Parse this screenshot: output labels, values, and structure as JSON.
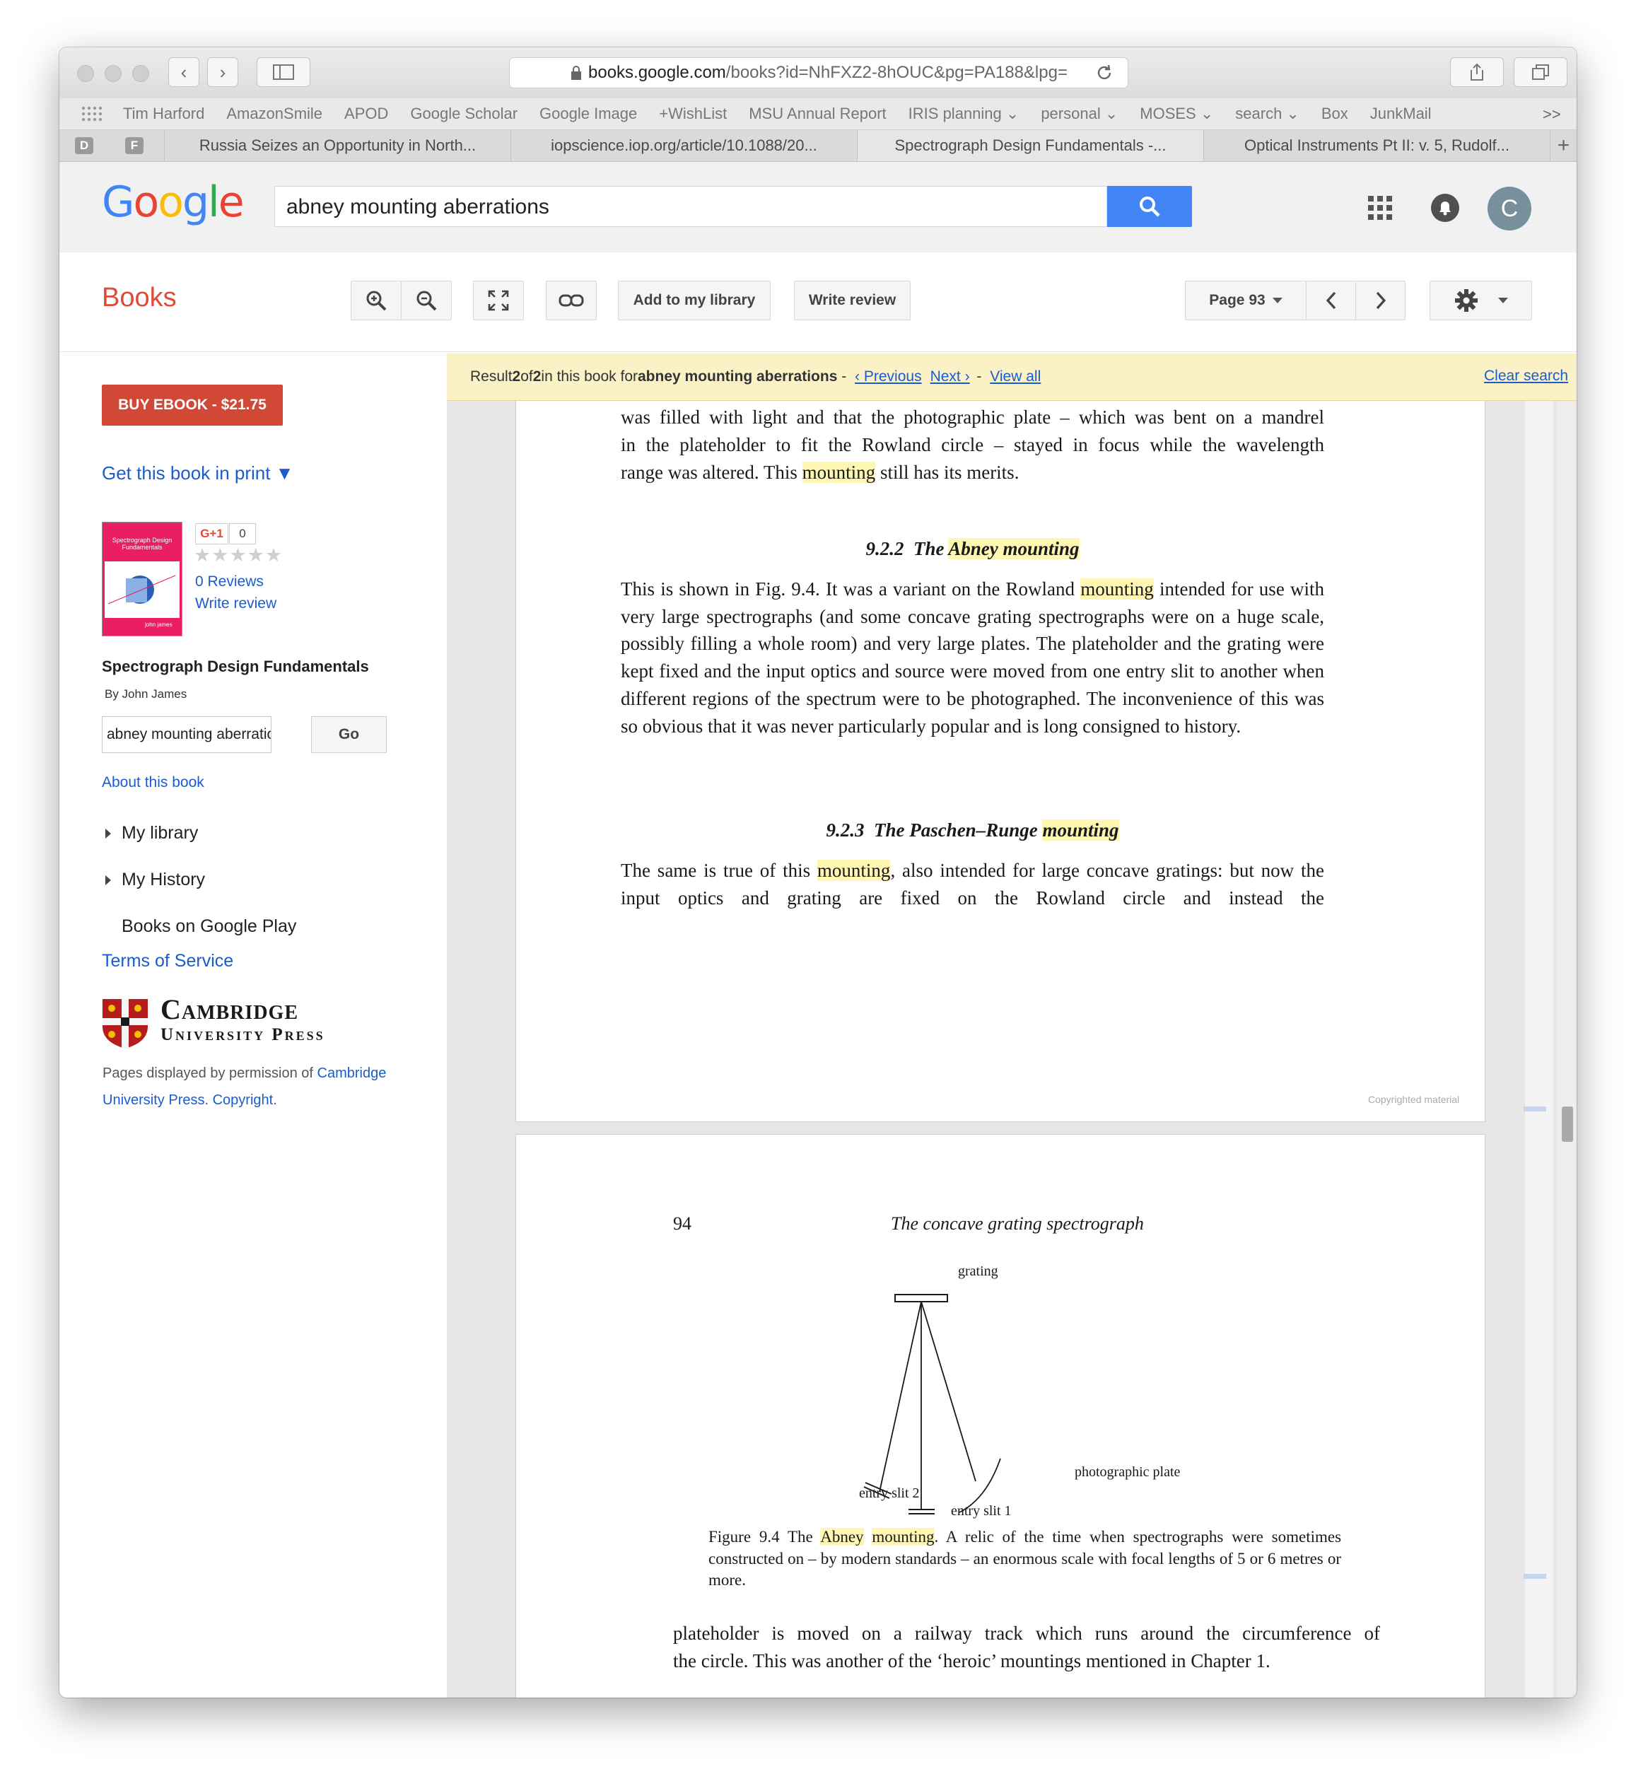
{
  "browser": {
    "url_host": "books.google.com",
    "url_path": "/books?id=NhFXZ2-8hOUC&pg=PA188&lpg=",
    "bookmarks": [
      "Tim Harford",
      "AmazonSmile",
      "APOD",
      "Google Scholar",
      "Google Image",
      "+WishList",
      "MSU Annual Report",
      "IRIS planning ⌄",
      "personal ⌄",
      "MOSES ⌄",
      "search ⌄",
      "Box",
      "JunkMail"
    ],
    "bookmarks_more": ">>",
    "pinned_tabs": [
      "D",
      "F"
    ],
    "tabs": [
      "Russia Seizes an Opportunity in North...",
      "iopscience.iop.org/article/10.1088/20...",
      "Spectrograph Design Fundamentals -...",
      "Optical Instruments Pt II: v. 5, Rudolf..."
    ],
    "new_tab": "+"
  },
  "google": {
    "logo_letters": [
      "G",
      "o",
      "o",
      "g",
      "l",
      "e"
    ],
    "logo_colors": [
      "#4285f4",
      "#ea4335",
      "#fbbc05",
      "#4285f4",
      "#34a853",
      "#ea4335"
    ],
    "query": "abney mounting aberrations",
    "avatar_letter": "C"
  },
  "books_bar": {
    "title": "Books",
    "add_library": "Add to my library",
    "write_review": "Write review",
    "page_label": "Page 93"
  },
  "result_bar": {
    "prefix": "Result ",
    "n": "2",
    "of": " of ",
    "total": "2",
    "mid": " in this book for ",
    "query": "abney mounting aberrations",
    "sep1": " - ",
    "previous": "‹ Previous",
    "next": "Next ›",
    "sep2": " - ",
    "view_all": "View all",
    "clear": "Clear search"
  },
  "sidebar": {
    "buy": "BUY EBOOK - $21.75",
    "get_print": "Get this book in print ▼",
    "gplus": "G+1",
    "gplus_count": "0",
    "stars": "★★★★★",
    "reviews": "0 Reviews",
    "write_review": "Write review",
    "cover_title": "Spectrograph Design Fundamentals",
    "cover_author": "john james",
    "book_title": "Spectrograph Design Fundamentals",
    "author": "By John James",
    "search_value": "abney mounting aberrations",
    "go": "Go",
    "about": "About this book",
    "my_library": "My library",
    "my_history": "My History",
    "play": "Books on Google Play",
    "terms": "Terms of Service",
    "publisher_line1": "Cambridge",
    "publisher_line2": "University Press",
    "perm_prefix": "Pages displayed by permission of ",
    "perm_link": "Cambridge University Press",
    "perm_copy": "Copyright",
    "perm_period": "."
  },
  "page93": {
    "line1": "was filled with light and that the photographic plate – which was bent on a mandrel",
    "line2": "in the plateholder to fit the Rowland circle – stayed in focus while the wavelength",
    "line3a": "range was altered. This ",
    "line3hl": "mounting",
    "line3b": " still has its merits.",
    "h1_num": "9.2.2",
    "h1_the": "The ",
    "h1_hl": "Abney mounting",
    "p1a": "This is shown in Fig. 9.4. It was a variant on the Rowland ",
    "p1hl": "mounting",
    "p1b": " intended for use with very large spectrographs (and some concave grating spectrographs were on a huge scale, possibly filling a whole room) and very large plates. The plateholder and the grating were kept fixed and the input optics and source were moved from one entry slit to another when different regions of the spectrum were to be photographed. The inconvenience of this was so obvious that it was never particularly popular and is long consigned to history.",
    "h2_num": "9.2.3",
    "h2_the": "The Paschen–Runge ",
    "h2_hl": "mounting",
    "p2a": "The same is true of this ",
    "p2hl": "mounting",
    "p2b": ", also intended for large concave gratings: but now the input optics and grating are fixed on the Rowland circle and instead the",
    "copyright": "Copyrighted material"
  },
  "page94": {
    "number": "94",
    "running_head": "The concave grating spectrograph",
    "label_grating": "grating",
    "label_plate": "photographic plate",
    "label_slit2": "entry slit 2",
    "label_slit1": "entry slit 1",
    "cap_prefix": "Figure 9.4 The ",
    "cap_hl1": "Abney",
    "cap_hl2": "mounting",
    "cap_rest": ". A relic of the time when spectrographs were sometimes constructed on – by modern standards – an enormous scale with focal lengths of 5 or 6 metres or more.",
    "line1": "plateholder is moved on a railway track which runs around the circumference of",
    "line2": "the circle. This was another of the ‘heroic’ mountings mentioned in Chapter 1."
  }
}
